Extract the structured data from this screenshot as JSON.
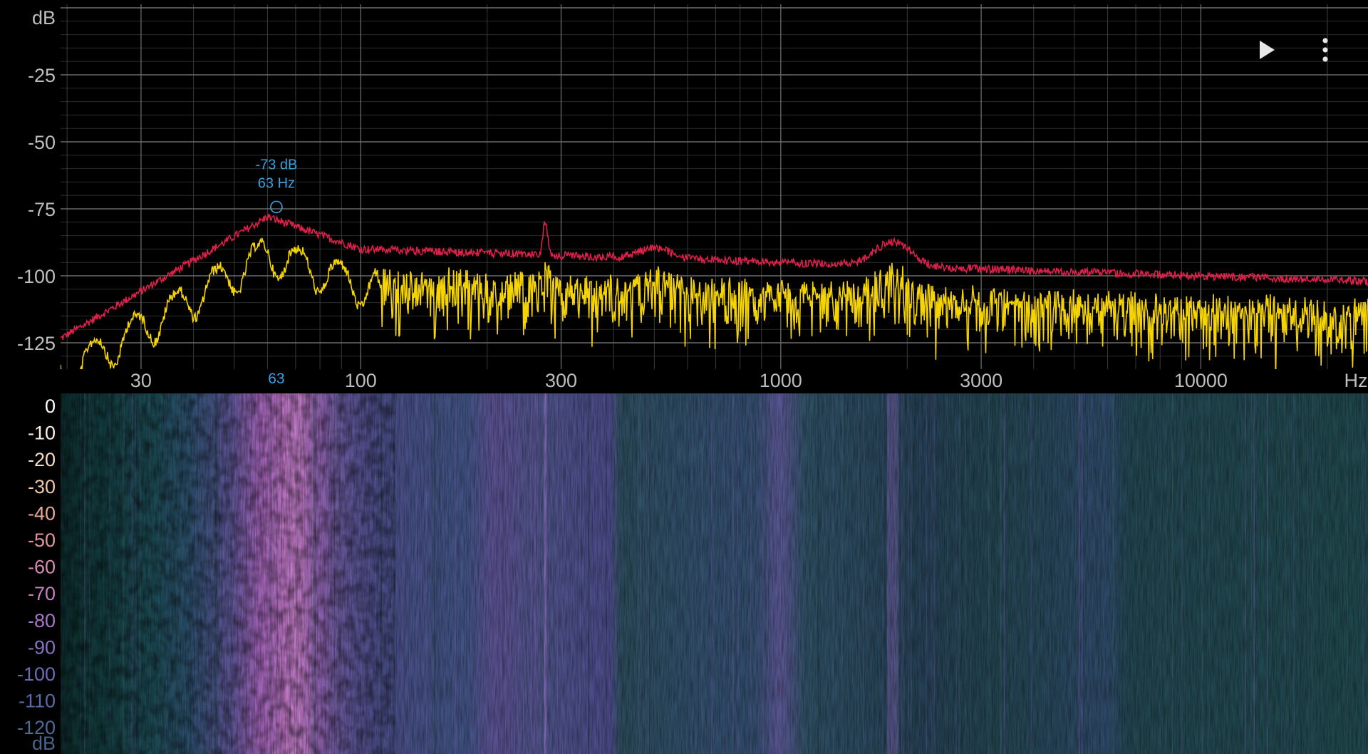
{
  "spectrum": {
    "y_unit": "dB",
    "x_unit": "Hz",
    "y_ticks": [
      {
        "value": -25,
        "label": "-25"
      },
      {
        "value": -50,
        "label": "-50"
      },
      {
        "value": -75,
        "label": "-75"
      },
      {
        "value": -100,
        "label": "-100"
      },
      {
        "value": -125,
        "label": "-125"
      }
    ],
    "x_ticks": [
      {
        "value": 30,
        "label": "30"
      },
      {
        "value": 100,
        "label": "100"
      },
      {
        "value": 300,
        "label": "300"
      },
      {
        "value": 1000,
        "label": "1000"
      },
      {
        "value": 3000,
        "label": "3000"
      },
      {
        "value": 10000,
        "label": "10000"
      }
    ],
    "peak": {
      "freq": 63,
      "db": -73,
      "db_label": "-73 dB",
      "hz_label": "63 Hz",
      "axis_label": "63"
    },
    "colors": {
      "live": "#f5d400",
      "peak_hold": "#e0204a",
      "marker": "#3aa0e0",
      "grid": "#4a4a4a",
      "label": "#bdbdbd"
    }
  },
  "spectrogram": {
    "unit": "dB",
    "scale": [
      {
        "label": "0",
        "color": "#ffffff"
      },
      {
        "label": "-10",
        "color": "#fbeee4"
      },
      {
        "label": "-20",
        "color": "#f6dcc4"
      },
      {
        "label": "-30",
        "color": "#f0c8a8"
      },
      {
        "label": "-40",
        "color": "#eaa996"
      },
      {
        "label": "-50",
        "color": "#e2969c"
      },
      {
        "label": "-60",
        "color": "#d78ab0"
      },
      {
        "label": "-70",
        "color": "#c67fc2"
      },
      {
        "label": "-80",
        "color": "#a876c8"
      },
      {
        "label": "-90",
        "color": "#8a70c4"
      },
      {
        "label": "-100",
        "color": "#6c6ab8"
      },
      {
        "label": "-110",
        "color": "#5d6aa8"
      },
      {
        "label": "-120",
        "color": "#4e6a96"
      }
    ]
  },
  "toolbar": {
    "play_icon": "play-icon",
    "menu_icon": "more-vert-icon"
  }
}
